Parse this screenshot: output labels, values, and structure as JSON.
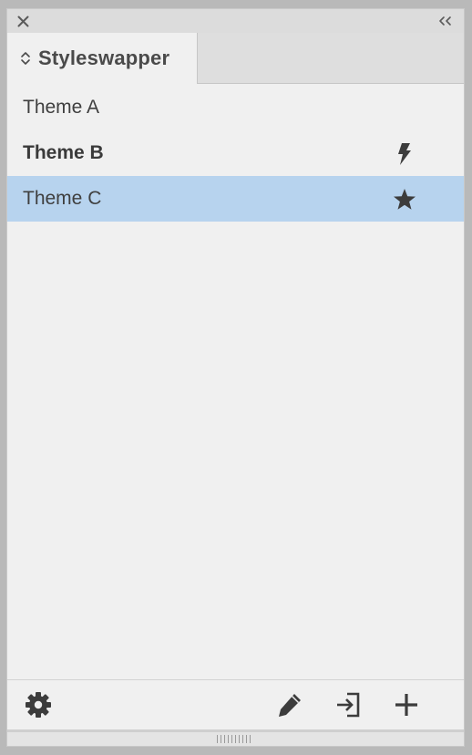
{
  "panel": {
    "tab_label": "Styleswapper"
  },
  "themes": [
    {
      "label": "Theme A",
      "bold": false,
      "selected": false,
      "icon": null
    },
    {
      "label": "Theme B",
      "bold": true,
      "selected": false,
      "icon": "lightning-icon"
    },
    {
      "label": "Theme C",
      "bold": false,
      "selected": true,
      "icon": "star-icon"
    }
  ],
  "footer": {
    "icons": [
      "gear-icon",
      "pencil-icon",
      "import-icon",
      "plus-icon"
    ]
  },
  "colors": {
    "selection": "#b7d3ee",
    "panel_bg": "#f0f0f0",
    "icon": "#3c3c3c"
  }
}
